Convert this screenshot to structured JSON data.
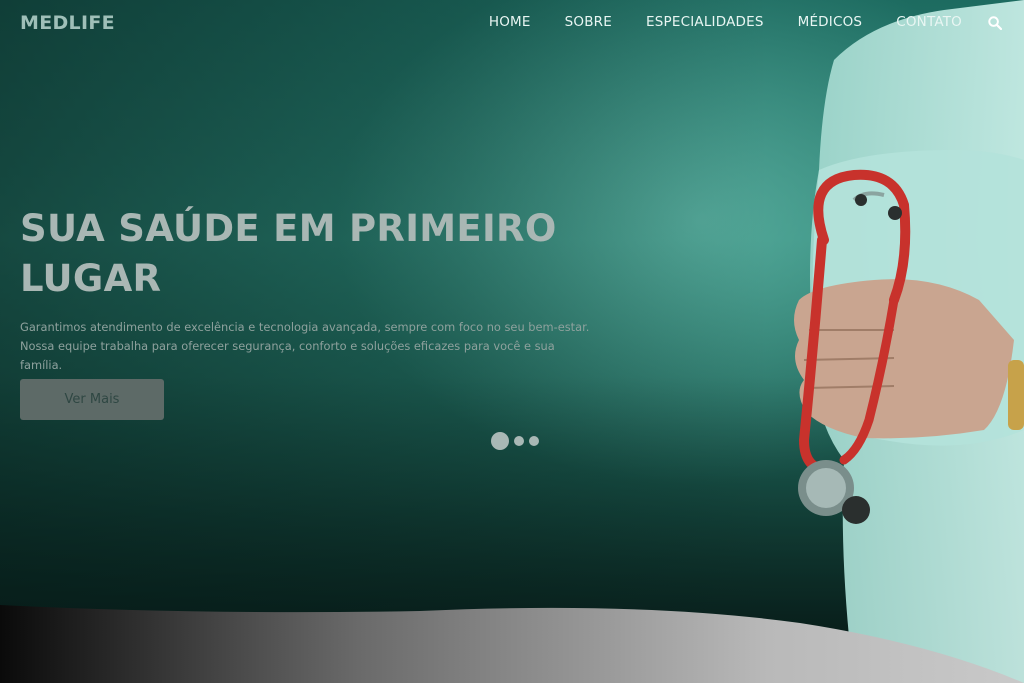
{
  "brand": {
    "logo": "MEDLIFE"
  },
  "nav": {
    "items": [
      "HOME",
      "SOBRE",
      "ESPECIALIDADES",
      "MÉDICOS",
      "CONTATO"
    ]
  },
  "hero": {
    "title": "SUA SAÚDE EM PRIMEIRO LUGAR",
    "text": "Garantimos atendimento de excelência e tecnologia avançada, sempre com foco no seu bem-estar. Nossa equipe trabalha para oferecer segurança, conforto e soluções eficazes para você e sua família.",
    "button": "Ver Mais"
  },
  "carousel": {
    "slides": 3,
    "active": 1
  },
  "icons": {
    "search": "search-icon"
  },
  "colors": {
    "accent": "#2a8475",
    "stethoscope": "#c8322c"
  }
}
